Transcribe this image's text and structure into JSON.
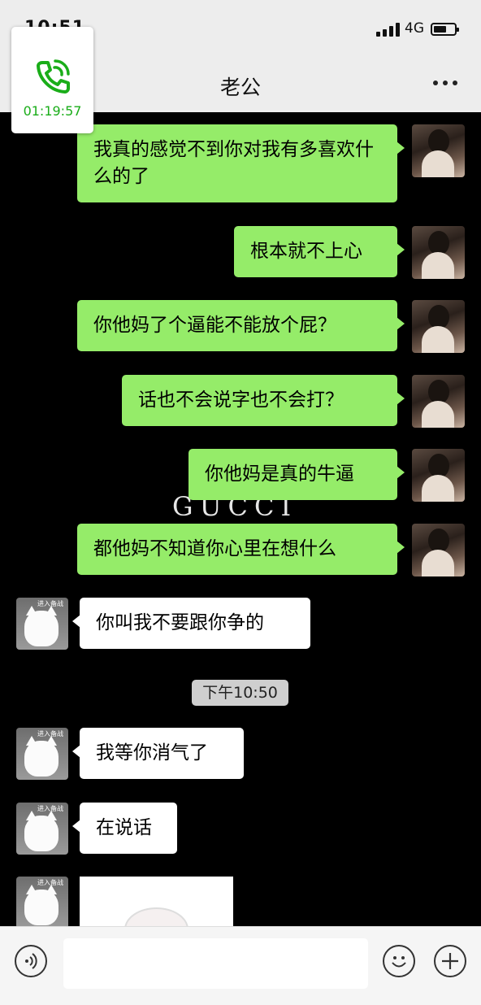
{
  "status_bar": {
    "time": "10:51",
    "network": "4G"
  },
  "header": {
    "title": "老公"
  },
  "call_widget": {
    "timer": "01:19:57"
  },
  "messages_out": [
    {
      "text": "我真的感觉不到你对我有多喜欢什么的了"
    },
    {
      "text": "根本就不上心"
    },
    {
      "text": "你他妈了个逼能不能放个屁？"
    },
    {
      "text": "话也不会说字也不会打？"
    },
    {
      "text": "你他妈是真的牛逼"
    },
    {
      "text": "都他妈不知道你心里在想什么"
    }
  ],
  "messages_in": [
    {
      "text": "你叫我不要跟你争的"
    },
    {
      "text": "我等你消气了"
    },
    {
      "text": "在说话"
    }
  ],
  "avatar_text": "进入备战",
  "timestamp": "下午10:50",
  "watermark": "GUCCI",
  "input": {
    "placeholder": ""
  }
}
